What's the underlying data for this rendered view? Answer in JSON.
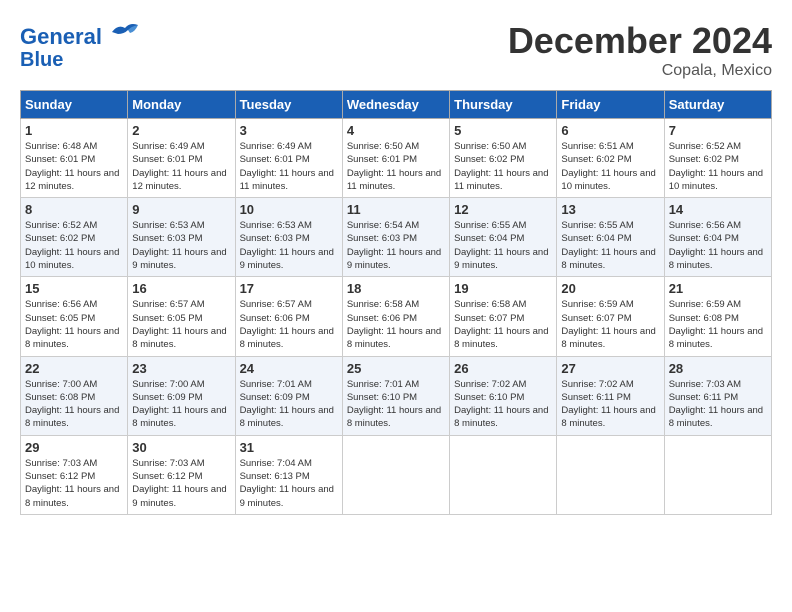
{
  "header": {
    "logo_line1": "General",
    "logo_line2": "Blue",
    "month_title": "December 2024",
    "location": "Copala, Mexico"
  },
  "days_of_week": [
    "Sunday",
    "Monday",
    "Tuesday",
    "Wednesday",
    "Thursday",
    "Friday",
    "Saturday"
  ],
  "weeks": [
    [
      {
        "day": "1",
        "info": "Sunrise: 6:48 AM\nSunset: 6:01 PM\nDaylight: 11 hours and 12 minutes."
      },
      {
        "day": "2",
        "info": "Sunrise: 6:49 AM\nSunset: 6:01 PM\nDaylight: 11 hours and 12 minutes."
      },
      {
        "day": "3",
        "info": "Sunrise: 6:49 AM\nSunset: 6:01 PM\nDaylight: 11 hours and 11 minutes."
      },
      {
        "day": "4",
        "info": "Sunrise: 6:50 AM\nSunset: 6:01 PM\nDaylight: 11 hours and 11 minutes."
      },
      {
        "day": "5",
        "info": "Sunrise: 6:50 AM\nSunset: 6:02 PM\nDaylight: 11 hours and 11 minutes."
      },
      {
        "day": "6",
        "info": "Sunrise: 6:51 AM\nSunset: 6:02 PM\nDaylight: 11 hours and 10 minutes."
      },
      {
        "day": "7",
        "info": "Sunrise: 6:52 AM\nSunset: 6:02 PM\nDaylight: 11 hours and 10 minutes."
      }
    ],
    [
      {
        "day": "8",
        "info": "Sunrise: 6:52 AM\nSunset: 6:02 PM\nDaylight: 11 hours and 10 minutes."
      },
      {
        "day": "9",
        "info": "Sunrise: 6:53 AM\nSunset: 6:03 PM\nDaylight: 11 hours and 9 minutes."
      },
      {
        "day": "10",
        "info": "Sunrise: 6:53 AM\nSunset: 6:03 PM\nDaylight: 11 hours and 9 minutes."
      },
      {
        "day": "11",
        "info": "Sunrise: 6:54 AM\nSunset: 6:03 PM\nDaylight: 11 hours and 9 minutes."
      },
      {
        "day": "12",
        "info": "Sunrise: 6:55 AM\nSunset: 6:04 PM\nDaylight: 11 hours and 9 minutes."
      },
      {
        "day": "13",
        "info": "Sunrise: 6:55 AM\nSunset: 6:04 PM\nDaylight: 11 hours and 8 minutes."
      },
      {
        "day": "14",
        "info": "Sunrise: 6:56 AM\nSunset: 6:04 PM\nDaylight: 11 hours and 8 minutes."
      }
    ],
    [
      {
        "day": "15",
        "info": "Sunrise: 6:56 AM\nSunset: 6:05 PM\nDaylight: 11 hours and 8 minutes."
      },
      {
        "day": "16",
        "info": "Sunrise: 6:57 AM\nSunset: 6:05 PM\nDaylight: 11 hours and 8 minutes."
      },
      {
        "day": "17",
        "info": "Sunrise: 6:57 AM\nSunset: 6:06 PM\nDaylight: 11 hours and 8 minutes."
      },
      {
        "day": "18",
        "info": "Sunrise: 6:58 AM\nSunset: 6:06 PM\nDaylight: 11 hours and 8 minutes."
      },
      {
        "day": "19",
        "info": "Sunrise: 6:58 AM\nSunset: 6:07 PM\nDaylight: 11 hours and 8 minutes."
      },
      {
        "day": "20",
        "info": "Sunrise: 6:59 AM\nSunset: 6:07 PM\nDaylight: 11 hours and 8 minutes."
      },
      {
        "day": "21",
        "info": "Sunrise: 6:59 AM\nSunset: 6:08 PM\nDaylight: 11 hours and 8 minutes."
      }
    ],
    [
      {
        "day": "22",
        "info": "Sunrise: 7:00 AM\nSunset: 6:08 PM\nDaylight: 11 hours and 8 minutes."
      },
      {
        "day": "23",
        "info": "Sunrise: 7:00 AM\nSunset: 6:09 PM\nDaylight: 11 hours and 8 minutes."
      },
      {
        "day": "24",
        "info": "Sunrise: 7:01 AM\nSunset: 6:09 PM\nDaylight: 11 hours and 8 minutes."
      },
      {
        "day": "25",
        "info": "Sunrise: 7:01 AM\nSunset: 6:10 PM\nDaylight: 11 hours and 8 minutes."
      },
      {
        "day": "26",
        "info": "Sunrise: 7:02 AM\nSunset: 6:10 PM\nDaylight: 11 hours and 8 minutes."
      },
      {
        "day": "27",
        "info": "Sunrise: 7:02 AM\nSunset: 6:11 PM\nDaylight: 11 hours and 8 minutes."
      },
      {
        "day": "28",
        "info": "Sunrise: 7:03 AM\nSunset: 6:11 PM\nDaylight: 11 hours and 8 minutes."
      }
    ],
    [
      {
        "day": "29",
        "info": "Sunrise: 7:03 AM\nSunset: 6:12 PM\nDaylight: 11 hours and 8 minutes."
      },
      {
        "day": "30",
        "info": "Sunrise: 7:03 AM\nSunset: 6:12 PM\nDaylight: 11 hours and 9 minutes."
      },
      {
        "day": "31",
        "info": "Sunrise: 7:04 AM\nSunset: 6:13 PM\nDaylight: 11 hours and 9 minutes."
      },
      {
        "day": "",
        "info": ""
      },
      {
        "day": "",
        "info": ""
      },
      {
        "day": "",
        "info": ""
      },
      {
        "day": "",
        "info": ""
      }
    ]
  ]
}
